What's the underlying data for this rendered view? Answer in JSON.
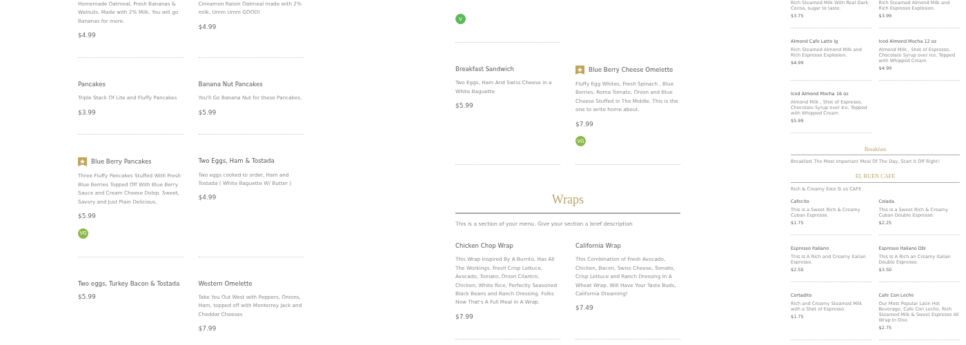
{
  "panels": [
    {
      "blocks": [
        {
          "kind": "row",
          "items": [
            {
              "featured": false,
              "description": "Homemade Oatmeal, Fresh Bananas & Walnuts. Made with 2% Milk. You will go Bananas for more.",
              "price": "$4.99"
            },
            {
              "featured": false,
              "description": "Cinnamon Raisin Oatmeal made with 2% milk. Umm Umm GOOD!",
              "price": "$4.99"
            }
          ]
        },
        {
          "kind": "row",
          "items": [
            {
              "featured": false,
              "name": "Pancakes",
              "description": "Triple Stack Of Lite and Fluffy Pancakes",
              "price": "$3.99"
            },
            {
              "featured": false,
              "name": "Banana Nut Pancakes",
              "description": "You'll Go Banana Nut for these Pancakes.",
              "price": "$5.99"
            }
          ]
        },
        {
          "kind": "row",
          "items": [
            {
              "featured": true,
              "name": "Blue Berry Pancakes",
              "description": "Three Fluffy Pancakes Stuffed With Fresh Blue Berries Topped Off With Blue Berry Sauce and Cream Cheese Dolop. Sweet, Savory and Just Plain Delicious.",
              "price": "$5.99",
              "badge": {
                "label": "VG",
                "color": "#8bb84a"
              }
            },
            {
              "featured": false,
              "name": "Two Eggs,  Ham & Tostada",
              "description": "Two eggs cooked to order, Ham and Tostada ( White Baguette W/ Butter )",
              "price": "$4.99"
            }
          ]
        },
        {
          "kind": "row",
          "items": [
            {
              "featured": false,
              "name": "Two eggs,  Turkey Bacon & Tostada",
              "price": "$5.99"
            },
            {
              "featured": false,
              "name": "Western Omelette",
              "description": "Take You Out West with Peppers, Onions, Ham, topped off with Monterrey Jack and Cheddar Cheeses",
              "price": "$7.99"
            }
          ]
        }
      ]
    },
    {
      "blocks": [
        {
          "kind": "row",
          "items": [
            {
              "featured": false,
              "badge": {
                "label": "V",
                "color": "#5cb85c"
              }
            },
            {
              "featured": false
            }
          ]
        },
        {
          "kind": "row",
          "items": [
            {
              "featured": false,
              "name": "Breakfast Sandwich",
              "description": "Two Eggs, Ham And Swiss Cheese in a White Baguette",
              "price": "$5.99"
            },
            {
              "featured": true,
              "name": "Blue Berry Cheese Omelette",
              "description": "Fluffy Egg Whites, Fresh Spinach , Blue Berries, Roma Tomato, Onion and Blue Cheese Stuffed in The Middle. This is the one to write home about.",
              "price": "$7.99",
              "badge": {
                "label": "VG",
                "color": "#8bb84a"
              }
            }
          ]
        },
        {
          "kind": "section",
          "title": "Wraps",
          "description": "This is a section of your menu. Give your section a brief description"
        },
        {
          "kind": "row",
          "items": [
            {
              "featured": false,
              "name": "Chicken Chop Wrap",
              "description": "This Wrap Inspired By A Burrito, Has All The Workings. Fresh Crisp Lettuce, Avocado, Tomato, Onion Cilantro, Chicken, White Rice, Perfectly Seasoned Black Beans and Ranch Dressing. Folks Now That's A Full Meal in A Wrap.",
              "price": "$7.99"
            },
            {
              "featured": false,
              "name": "California Wrap",
              "description": "This Combination of Fresh Avocado, Chicken, Bacon, Swiss Cheese, Tomato, Crisp Lettuce and Ranch Dressing In A Wheat Wrap. Will Have Your Taste Buds, California Dreaming!",
              "price": "$7.49"
            }
          ]
        }
      ]
    },
    {
      "blocks": [
        {
          "kind": "row",
          "items": [
            {
              "featured": false,
              "description": "Rich Steamed Milk With Real Dark Cocoa, sugar to taste.",
              "price": "$3.75"
            },
            {
              "featured": false,
              "description": "Rich Steamed Almond Milk and Rich Espresso Explosion.",
              "price": "$3.99"
            }
          ]
        },
        {
          "kind": "row",
          "items": [
            {
              "featured": false,
              "name": "Almond Cafe Latte lg",
              "description": "Rich Steamed Almond Milk and Rich Espresso Explosion.",
              "price": "$4.99"
            },
            {
              "featured": false,
              "name": "Iced Almond Mocha 12 oz",
              "description": "Almond Milk , Shot of Espresso, Chocolate Syrup over Ice, Topped with Whipped Cream",
              "price": "$4.99"
            }
          ]
        },
        {
          "kind": "row",
          "items": [
            {
              "featured": false,
              "name": "Iced Almond Mocha 16 oz",
              "description": "Almond Milk , Shot of Espresso, Chocolate Syrup over Ice, Topped with Whipped Cream",
              "price": "$5.99"
            }
          ]
        },
        {
          "kind": "section",
          "title": "Breakfast",
          "description": "Breakfast The Most Important Meal Of The Day, Start It Off Right!"
        },
        {
          "kind": "section",
          "title": "EL BUEN CAFE",
          "description": "Rich & Creamy Esto Si es CAFE"
        },
        {
          "kind": "row",
          "items": [
            {
              "featured": false,
              "name": "Cafecito",
              "description": "This is a Sweet Rich & Creamy Cuban Espresso.",
              "price": "$1.75"
            },
            {
              "featured": false,
              "name": "Colada",
              "description": "This is a Sweet Rich & Creamy Cuban Double Espresso.",
              "price": "$2.25"
            }
          ]
        },
        {
          "kind": "row",
          "items": [
            {
              "featured": false,
              "name": "Espresso Italiano",
              "description": "This Is A Rich and Creamy Italian Espresso.",
              "price": "$2.50"
            },
            {
              "featured": false,
              "name": "Espresso Italiano Dbl",
              "description": "This Is A Rich an Creamy Italian Double Espresso.",
              "price": "$3.50"
            }
          ]
        },
        {
          "kind": "row",
          "items": [
            {
              "featured": false,
              "name": "Cortadito",
              "description": "Rich and Creamy Steamed Milk with a Shot of Espresso.",
              "price": "$1.75"
            },
            {
              "featured": false,
              "name": "Cafe Con Leche",
              "description": "Our Most Popular Latin Hot Beverage, Cafe Con Leche, Rich Steamed Milk & Sweet Espresso All Wrap In One.",
              "price": "$2.75"
            }
          ]
        }
      ]
    }
  ]
}
